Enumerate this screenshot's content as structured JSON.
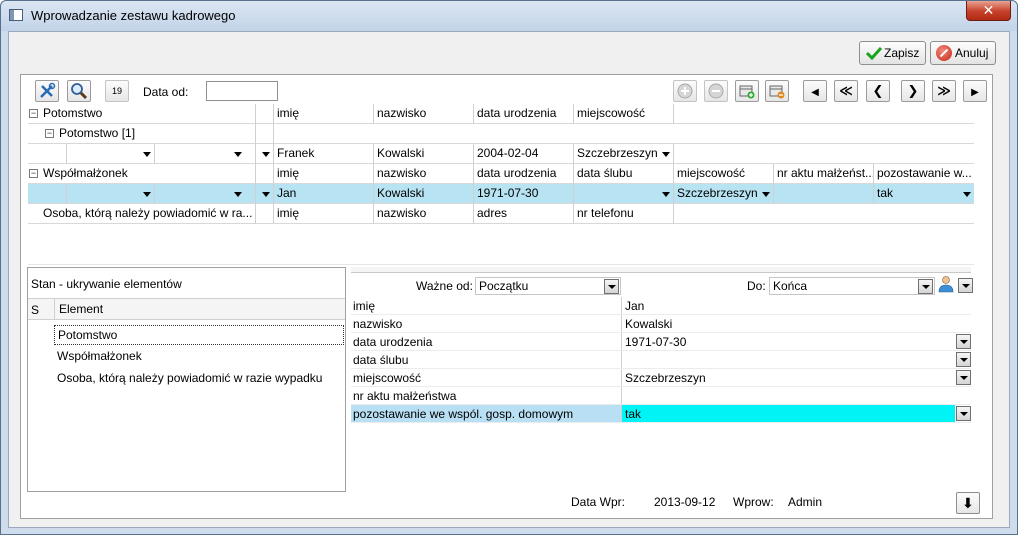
{
  "window": {
    "title": "Wprowadzanie zestawu kadrowego",
    "close_label": "✕"
  },
  "actions": {
    "save_label": "Zapisz",
    "cancel_label": "Anuluj"
  },
  "toolbar": {
    "date_from_label": "Data od:",
    "date_from_value": "",
    "calendar_glyph": "19",
    "nav": {
      "first": "◀",
      "prev_page": "≪",
      "prev": "❮",
      "next": "❯",
      "next_page": "≫",
      "last": "▶"
    }
  },
  "grid": {
    "rows": [
      {
        "label": "Potomstwo",
        "cols": [
          "imię",
          "nazwisko",
          "data urodzenia",
          "miejscowość"
        ]
      },
      {
        "label": "Potomstwo [1]"
      },
      {
        "values": [
          "Franek",
          "Kowalski",
          "2004-02-04",
          "Szczebrzeszyn"
        ]
      },
      {
        "label": "Współmałżonek",
        "cols": [
          "imię",
          "nazwisko",
          "data urodzenia",
          "data ślubu",
          "miejscowość",
          "nr aktu małżeńst...",
          "pozostawanie w..."
        ]
      },
      {
        "values": [
          "Jan",
          "Kowalski",
          "1971-07-30",
          "",
          "Szczebrzeszyn",
          "",
          "tak"
        ]
      },
      {
        "label": "Osoba, którą należy powiadomić w ra...",
        "cols": [
          "imię",
          "nazwisko",
          "adres",
          "nr telefonu"
        ]
      }
    ]
  },
  "state_panel": {
    "title": "Stan - ukrywanie elementów",
    "col_s": "S",
    "col_element": "Element",
    "items": [
      "Potomstwo",
      "Współmałżonek",
      "Osoba, którą należy powiadomić w razie wypadku"
    ]
  },
  "details": {
    "valid_from_label": "Ważne od:",
    "valid_from_value": "Początku",
    "to_label": "Do:",
    "to_value": "Końca",
    "props": [
      {
        "label": "imię",
        "value": "Jan"
      },
      {
        "label": "nazwisko",
        "value": "Kowalski"
      },
      {
        "label": "data urodzenia",
        "value": "1971-07-30"
      },
      {
        "label": "data ślubu",
        "value": ""
      },
      {
        "label": "miejscowość",
        "value": "Szczebrzeszyn"
      },
      {
        "label": "nr aktu małżeństwa",
        "value": ""
      },
      {
        "label": "pozostawanie we wspól. gosp. domowym",
        "value": "tak"
      }
    ]
  },
  "footer": {
    "entry_date_label": "Data Wpr:",
    "entry_date_value": "2013-09-12",
    "entered_by_label": "Wprow:",
    "entered_by_value": "Admin",
    "down_glyph": "⬇"
  },
  "colors": {
    "selected_row": "#b7e3f3",
    "highlight_value": "#00f4f6",
    "window_frame": "#cfdcec"
  }
}
